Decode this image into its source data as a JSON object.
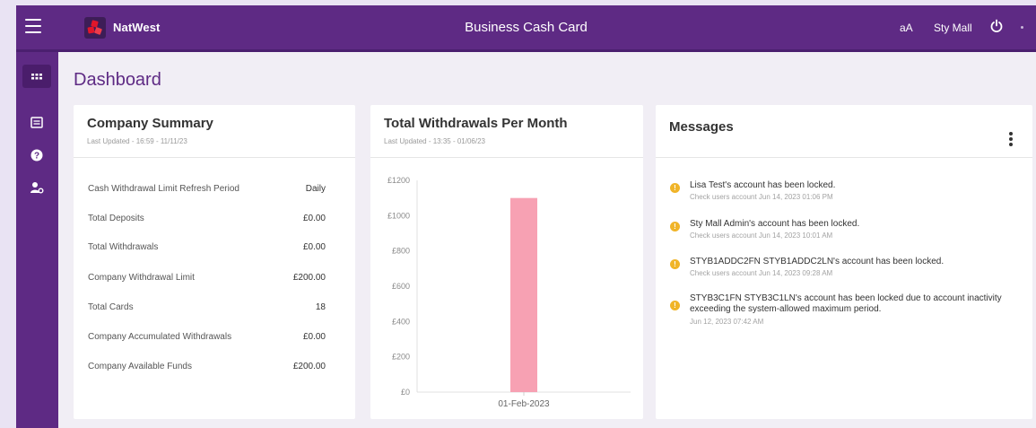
{
  "header": {
    "brand": "NatWest",
    "app_title": "Business Cash Card",
    "text_size": "aA",
    "user": "Sty Mall"
  },
  "sidebar": {
    "items": [
      {
        "icon": "dashboard-grid-icon",
        "active": true
      },
      {
        "icon": "list-card-icon",
        "active": false
      },
      {
        "icon": "help-icon",
        "active": false
      },
      {
        "icon": "user-settings-icon",
        "active": false
      }
    ]
  },
  "page": {
    "title": "Dashboard"
  },
  "company_summary": {
    "title": "Company Summary",
    "updated": "Last Updated - 16:59 - 11/11/23",
    "rows": [
      {
        "label": "Cash Withdrawal Limit Refresh Period",
        "value": "Daily"
      },
      {
        "label": "Total Deposits",
        "value": "£0.00"
      },
      {
        "label": "Total Withdrawals",
        "value": "£0.00"
      },
      {
        "label": "Company Withdrawal Limit",
        "value": "£200.00"
      },
      {
        "label": "Total Cards",
        "value": "18"
      },
      {
        "label": "Company Accumulated Withdrawals",
        "value": "£0.00"
      },
      {
        "label": "Company Available Funds",
        "value": "£200.00"
      }
    ]
  },
  "withdrawals": {
    "title": "Total Withdrawals Per Month",
    "updated": "Last Updated - 13:35 - 01/06/23"
  },
  "chart_data": {
    "type": "bar",
    "categories": [
      "01-Feb-2023"
    ],
    "values": [
      1100
    ],
    "yticks": [
      "£1200",
      "£1000",
      "£800",
      "£600",
      "£400",
      "£200",
      "£0"
    ],
    "ylim": [
      0,
      1200
    ],
    "bar_color": "#f7a1b3",
    "grid": false
  },
  "messages": {
    "title": "Messages",
    "items": [
      {
        "text": "Lisa Test's account has been locked.",
        "meta": "Check users account Jun 14, 2023 01:06 PM"
      },
      {
        "text": "Sty Mall Admin's account has been locked.",
        "meta": "Check users account Jun 14, 2023 10:01 AM"
      },
      {
        "text": "STYB1ADDC2FN STYB1ADDC2LN's account has been locked.",
        "meta": "Check users account Jun 14, 2023 09:28 AM"
      },
      {
        "text": "STYB3C1FN STYB3C1LN's account has been locked due to account inactivity exceeding the system-allowed maximum period.",
        "meta": "Jun 12, 2023 07:42 AM"
      }
    ]
  },
  "colors": {
    "brand_purple": "#5e2a84",
    "warning": "#f0b428",
    "bar": "#f7a1b3"
  }
}
